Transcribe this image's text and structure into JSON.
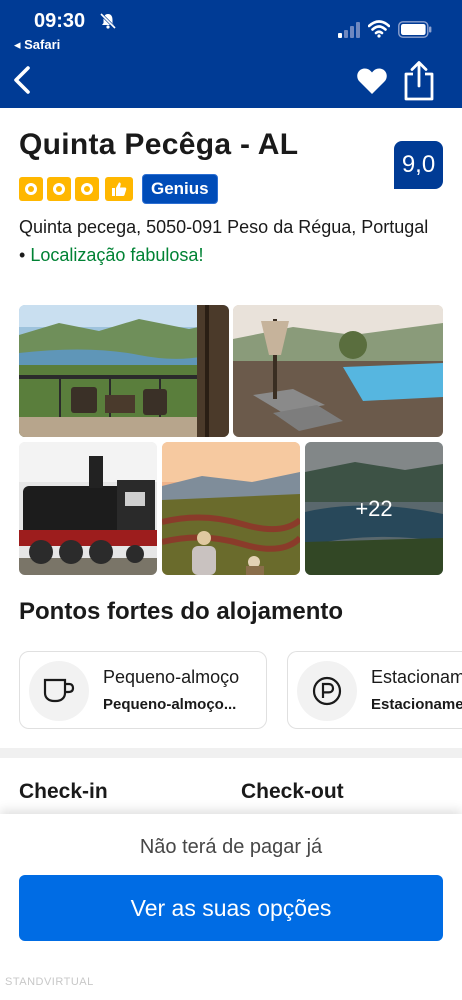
{
  "status_bar": {
    "time": "09:30",
    "back_app": "◂ Safari"
  },
  "nav": {
    "back_icon": "chevron-left-icon",
    "favorite_icon": "heart-icon",
    "share_icon": "share-icon"
  },
  "hotel": {
    "name": "Quinta Pecêga - AL",
    "score": "9,0",
    "stars": 3,
    "genius_label": "Genius",
    "address": "Quinta pecega, 5050-091 Peso da Régua, Portugal",
    "bullet": "•",
    "location_highlight": "Localização fabulosa!"
  },
  "gallery": {
    "more_photos_label": "+22"
  },
  "highlights": {
    "title": "Pontos fortes do alojamento",
    "items": [
      {
        "icon": "coffee-cup-icon",
        "title": "Pequeno-almoço",
        "subtitle": "Pequeno-almoço..."
      },
      {
        "icon": "parking-icon",
        "title": "Estacionamento",
        "subtitle": "Estacionamento"
      }
    ]
  },
  "stay": {
    "checkin_label": "Check-in",
    "checkout_label": "Check-out"
  },
  "footer": {
    "no_payment_text": "Não terá de pagar já",
    "cta_label": "Ver as suas opções",
    "watermark": "STANDVIRTUAL"
  },
  "colors": {
    "brand_blue": "#003b95",
    "cta_blue": "#006ce4",
    "star_yellow": "#ffb700",
    "green": "#008234"
  }
}
